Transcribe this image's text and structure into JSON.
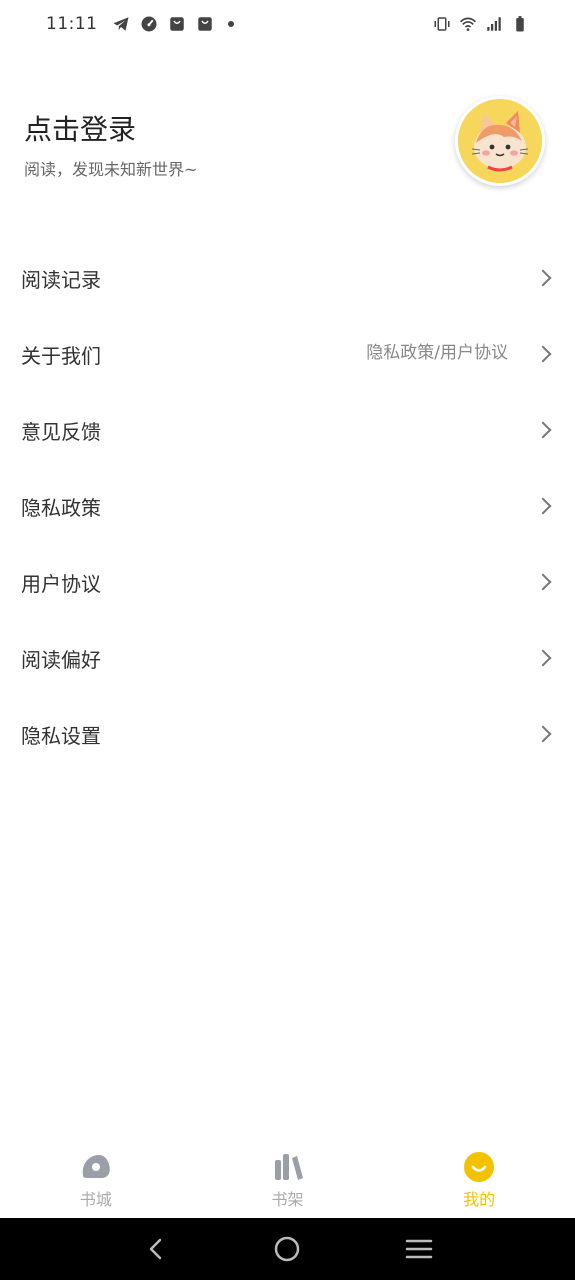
{
  "status_bar": {
    "time": "11:11",
    "left_icons": [
      "telegram-icon",
      "speedometer-icon",
      "shopping-bag-icon",
      "shopping-bag-icon",
      "dot-icon"
    ],
    "right_icons": [
      "vibrate-icon",
      "wifi-icon",
      "signal-icon",
      "battery-icon"
    ]
  },
  "profile": {
    "title": "点击登录",
    "subtitle": "阅读，发现未知新世界~",
    "avatar": "cat-avatar-icon"
  },
  "menu": {
    "items": [
      {
        "label": "阅读记录",
        "extra": ""
      },
      {
        "label": "关于我们",
        "extra": "隐私政策/用户协议"
      },
      {
        "label": "意见反馈",
        "extra": ""
      },
      {
        "label": "隐私政策",
        "extra": ""
      },
      {
        "label": "用户协议",
        "extra": ""
      },
      {
        "label": "阅读偏好",
        "extra": ""
      },
      {
        "label": "隐私设置",
        "extra": ""
      }
    ]
  },
  "tabbar": {
    "tabs": [
      {
        "label": "书城",
        "icon": "bookstore-icon",
        "active": false
      },
      {
        "label": "书架",
        "icon": "bookshelf-icon",
        "active": false
      },
      {
        "label": "我的",
        "icon": "profile-smile-icon",
        "active": true
      }
    ]
  },
  "colors": {
    "accent": "#f2c200",
    "avatar_bg": "#f7d65c",
    "text_primary": "#333333",
    "text_secondary": "#888888",
    "navbar_bg": "#000000"
  },
  "navbar": {
    "buttons": [
      "back-icon",
      "home-icon",
      "menu-icon"
    ]
  }
}
